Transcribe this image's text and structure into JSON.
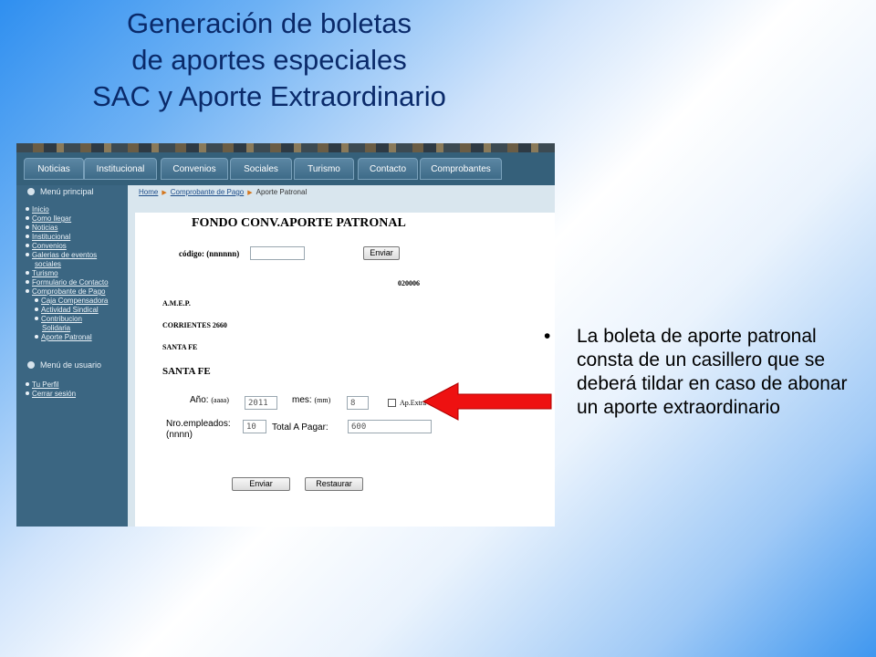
{
  "slide": {
    "title_lines": [
      "Generación de boletas",
      "de aportes especiales",
      "SAC y Aporte Extraordinario"
    ],
    "bullet_text": "La boleta de aporte patronal consta de un casillero que se deberá tildar en caso de abonar un aporte extraordinario"
  },
  "nav": {
    "tabs": [
      "Noticias",
      "Institucional",
      "Convenios",
      "Sociales",
      "Turismo",
      "Contacto",
      "Comprobantes"
    ]
  },
  "sidebar": {
    "main_menu_heading": "Menú principal",
    "main_items": [
      "Inicio",
      "Como llegar",
      "Noticias",
      "Institucional",
      "Convenios",
      "Galerias de eventos",
      "sociales",
      "Turismo",
      "Formulario de Contacto",
      "Comprobante de Pago"
    ],
    "sub_items": [
      "Caja Compensadora",
      "Actividad Sindical",
      "Contribucion",
      "Solidaria",
      "Aporte Patronal"
    ],
    "user_menu_heading": "Menú de usuario",
    "user_items": [
      "Tu Perfil",
      "Cerrar sesión"
    ]
  },
  "breadcrumb": {
    "home": "Home",
    "section": "Comprobante de Pago",
    "current": "Aporte Patronal"
  },
  "form": {
    "heading": "FONDO CONV.APORTE PATRONAL",
    "codigo_label": "código: (nnnnnn)",
    "codigo_value": "",
    "enviar_top": "Enviar",
    "code_number": "020006",
    "name": "A.M.E.P.",
    "address": "CORRIENTES 2660",
    "city": "SANTA FE",
    "province": "SANTA FE",
    "anio_label": "Año:",
    "anio_hint": "(aaaa)",
    "anio_value": "2011",
    "mes_label": "mes:",
    "mes_hint": "(mm)",
    "mes_value": "8",
    "ap_extra_label": "Ap.Extra",
    "empleados_label": "Nro.empleados:",
    "empleados_hint": "(nnnn)",
    "empleados_value": "10",
    "total_label": "Total A Pagar:",
    "total_value": "600",
    "submit_label": "Enviar",
    "reset_label": "Restaurar"
  },
  "colors": {
    "arrow": "#ee1111",
    "title": "#0a2a6a",
    "sidebar": "#3b6682"
  }
}
